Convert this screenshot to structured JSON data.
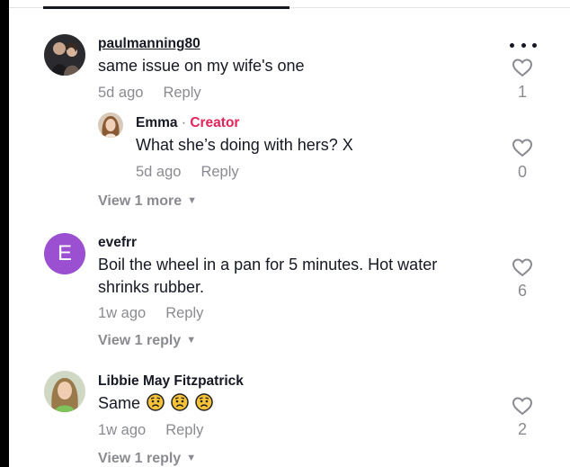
{
  "colors": {
    "username": "#161823",
    "meta": "#8a8b91",
    "creator_badge": "#e2245a",
    "letter_avatar_bg": "#9b4fd1"
  },
  "comments": [
    {
      "username": "paulmanning80",
      "text": "same issue on my wife's one",
      "time": "5d ago",
      "reply_label": "Reply",
      "likes": "1",
      "avatar": "photo-couple-avatar",
      "more_icon": "ellipsis-icon",
      "replies": [
        {
          "username": "Emma",
          "separator": "·",
          "badge": "Creator",
          "text": "What she’s doing with hers? X",
          "time": "5d ago",
          "reply_label": "Reply",
          "likes": "0",
          "avatar": "photo-woman-avatar"
        }
      ],
      "view_more": "View 1 more"
    },
    {
      "username": "evefrr",
      "avatar_letter": "E",
      "text": "Boil the wheel in a pan for 5 minutes. Hot water shrinks rubber.",
      "time": "1w ago",
      "reply_label": "Reply",
      "likes": "6",
      "view_more": "View 1 reply"
    },
    {
      "username": "Libbie May Fitzpatrick",
      "text": "Same",
      "emojis": [
        "worried-face",
        "worried-face",
        "worried-face"
      ],
      "time": "1w ago",
      "reply_label": "Reply",
      "likes": "2",
      "avatar": "photo-woman-avatar",
      "view_more": "View 1 reply"
    }
  ]
}
